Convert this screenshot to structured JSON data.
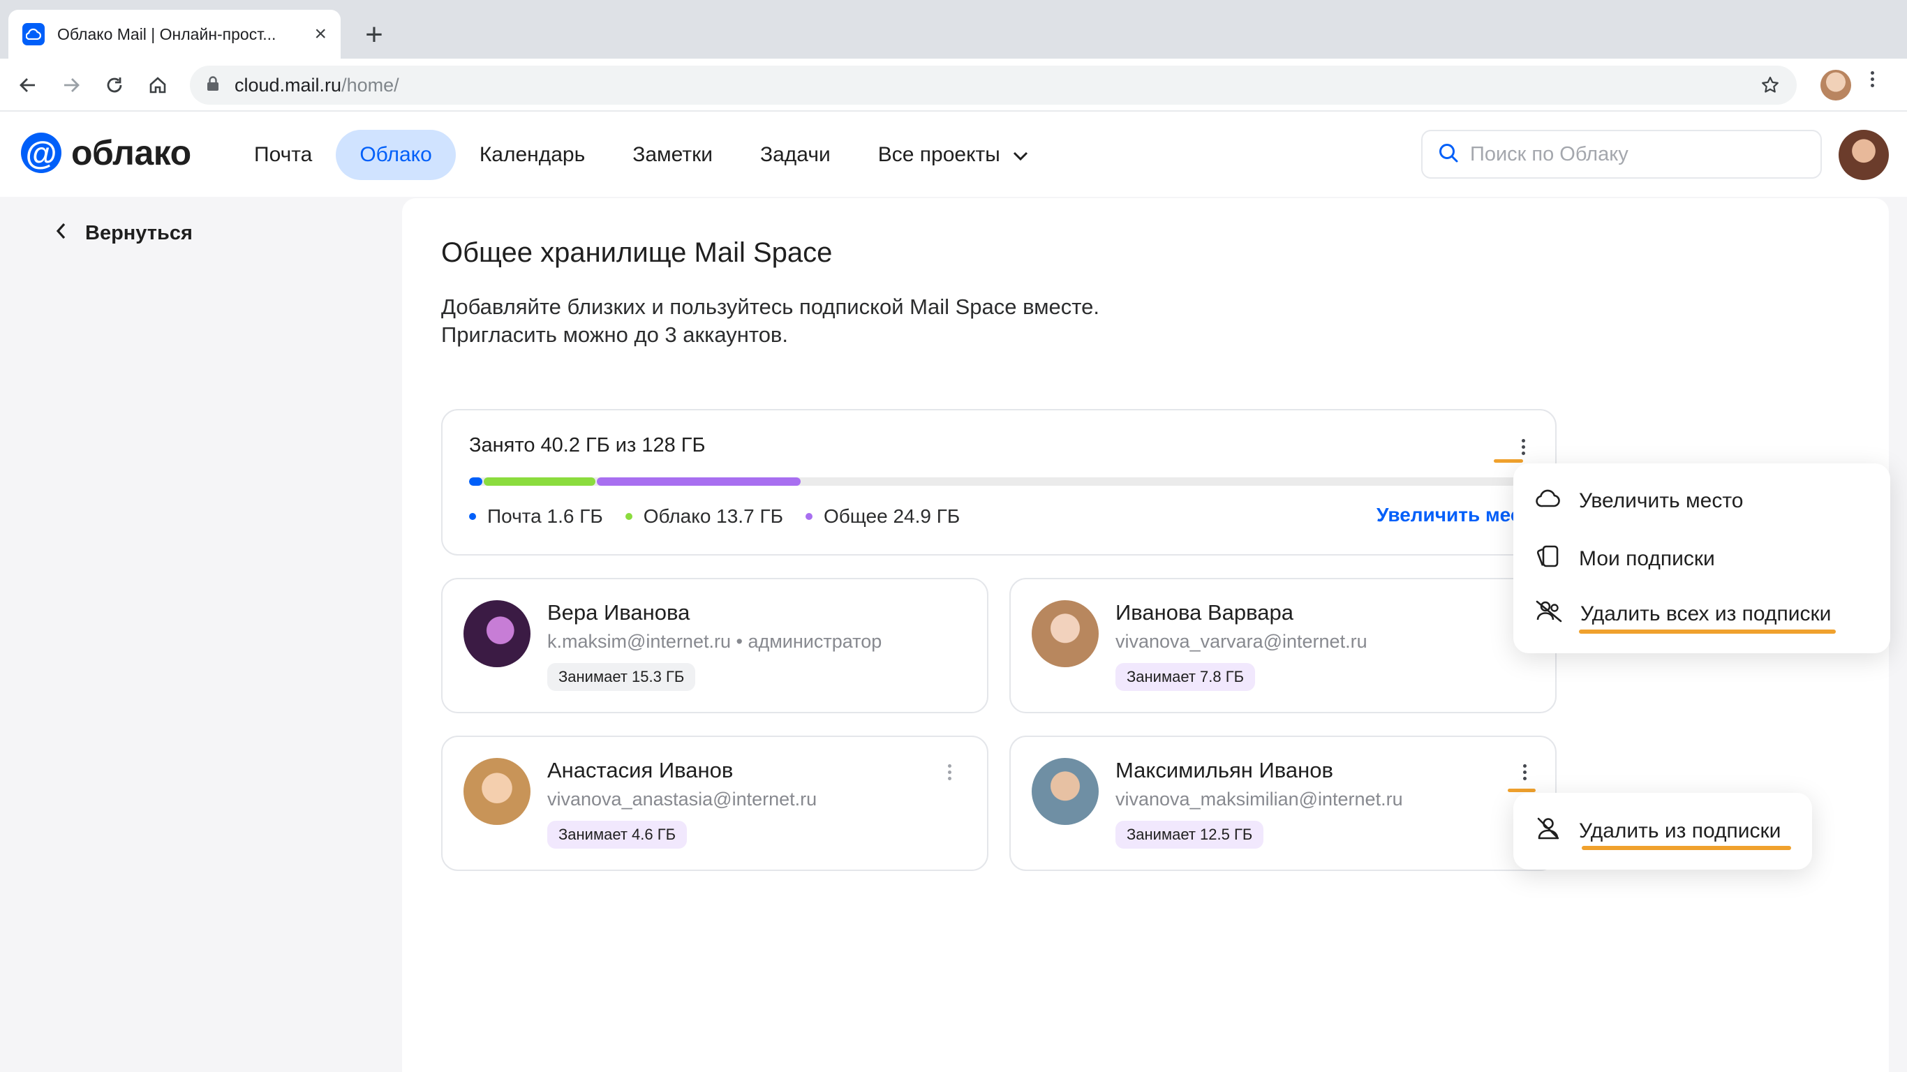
{
  "browser": {
    "tab_title": "Облако Mail | Онлайн-прост...",
    "url_host": "cloud.mail.ru",
    "url_path": "/home/"
  },
  "header": {
    "logo_text": "облако",
    "nav": [
      {
        "label": "Почта",
        "active": false
      },
      {
        "label": "Облако",
        "active": true
      },
      {
        "label": "Календарь",
        "active": false
      },
      {
        "label": "Заметки",
        "active": false
      },
      {
        "label": "Задачи",
        "active": false
      },
      {
        "label": "Все проекты",
        "active": false
      }
    ],
    "search_placeholder": "Поиск по Облаку"
  },
  "back_label": "Вернуться",
  "page": {
    "title": "Общее хранилище Mail Space",
    "description_line1": "Добавляйте близких и пользуйтесь подпиской Mail Space вместе.",
    "description_line2": "Пригласить можно до 3 аккаунтов."
  },
  "storage": {
    "title": "Занято 40.2 ГБ из 128 ГБ",
    "total_gb": 128,
    "segments": [
      {
        "label": "Почта 1.6 ГБ",
        "gb": 1.6,
        "color": "#005ff9"
      },
      {
        "label": "Облако 13.7 ГБ",
        "gb": 13.7,
        "color": "#8bdc3e"
      },
      {
        "label": "Общее 24.9 ГБ",
        "gb": 24.9,
        "color": "#a86ff0"
      }
    ],
    "increase_link": "Увеличить место"
  },
  "members": [
    {
      "name": "Вера Иванова",
      "email": "k.maksim@internet.ru",
      "role": "администратор",
      "usage": "Занимает 15.3 ГБ",
      "chip_color": "#f0f1f3"
    },
    {
      "name": "Иванова Варвара",
      "email": "vivanova_varvara@internet.ru",
      "role": "",
      "usage": "Занимает 7.8 ГБ",
      "chip_color": "#f1e8fd"
    },
    {
      "name": "Анастасия Иванов",
      "email": "vivanova_anastasia@internet.ru",
      "role": "",
      "usage": "Занимает 4.6 ГБ",
      "chip_color": "#f1e8fd"
    },
    {
      "name": "Максимильян Иванов",
      "email": "vivanova_maksimilian@internet.ru",
      "role": "",
      "usage": "Занимает 12.5 ГБ",
      "chip_color": "#f1e8fd"
    }
  ],
  "storage_menu": {
    "items": [
      {
        "label": "Увеличить место",
        "icon": "cloud-icon"
      },
      {
        "label": "Мои подписки",
        "icon": "subscriptions-icon"
      },
      {
        "label": "Удалить всех из подписки",
        "icon": "remove-users-icon"
      }
    ]
  },
  "member_menu": {
    "items": [
      {
        "label": "Удалить из подписки",
        "icon": "remove-user-icon"
      }
    ]
  },
  "colors": {
    "accent": "#005ff9",
    "highlight": "#f0a12d"
  }
}
